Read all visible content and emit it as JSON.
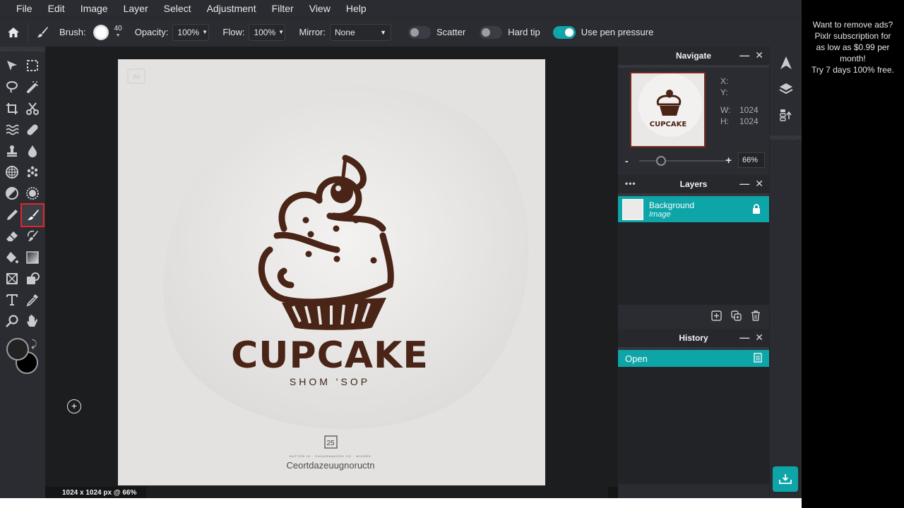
{
  "menubar": {
    "items": [
      "File",
      "Edit",
      "Image",
      "Layer",
      "Select",
      "Adjustment",
      "Filter",
      "View",
      "Help"
    ]
  },
  "options": {
    "brush_label": "Brush:",
    "brush_size": "40",
    "opacity_label": "Opacity:",
    "opacity_value": "100%",
    "flow_label": "Flow:",
    "flow_value": "100%",
    "mirror_label": "Mirror:",
    "mirror_value": "None",
    "scatter_label": "Scatter",
    "scatter_on": false,
    "hardtip_label": "Hard tip",
    "hardtip_on": false,
    "pressure_label": "Use pen pressure",
    "pressure_on": true
  },
  "toolbar": {
    "tools": [
      "arrange-tool",
      "marquee-select-tool",
      "lasso-select-tool",
      "magic-wand-tool",
      "crop-tool",
      "cutout-tool",
      "liquify-tool",
      "heal-tool",
      "clone-stamp-tool",
      "blur-tool",
      "sponge-tool",
      "pixelate-tool",
      "dodge-burn-tool",
      "color-replace-tool",
      "pencil-tool",
      "brush-tool",
      "eraser-tool",
      "smudge-brush-tool",
      "fill-tool",
      "gradient-tool",
      "frame-tool",
      "shape-tool",
      "text-tool",
      "color-picker-tool",
      "zoom-tool",
      "hand-tool"
    ],
    "active_tool": "brush-tool",
    "foreground_color": "#232323",
    "background_color": "#000000"
  },
  "canvas": {
    "artwork": {
      "title": "CUPCAKE",
      "subtitle": "SHOM 'SOP",
      "badge": "25",
      "small_line": "BATTER IS · SUGARBAKERS CO · MIXERS",
      "footer_text": "Ceortdazeuugnoructn",
      "ai_mark": "AI"
    },
    "status": "1024 x 1024 px @ 66%"
  },
  "navigate": {
    "title": "Navigate",
    "x_label": "X:",
    "y_label": "Y:",
    "w_label": "W:",
    "w_value": "1024",
    "h_label": "H:",
    "h_value": "1024",
    "zoom_minus": "-",
    "zoom_plus": "+",
    "zoom_value": "66%",
    "zoom_fraction": 0.25
  },
  "layers": {
    "title": "Layers",
    "items": [
      {
        "name": "Background",
        "type": "Image",
        "locked": true
      }
    ]
  },
  "history": {
    "title": "History",
    "items": [
      "Open"
    ]
  },
  "ad": {
    "lines": [
      "Want to remove ads?",
      "Pixlr subscription for",
      "as low as $0.99 per",
      "month!",
      "Try 7 days 100% free."
    ]
  },
  "colors": {
    "accent": "#0da5a8",
    "active_tool_border": "#e2252b",
    "artwork_brown": "#4a2416"
  }
}
